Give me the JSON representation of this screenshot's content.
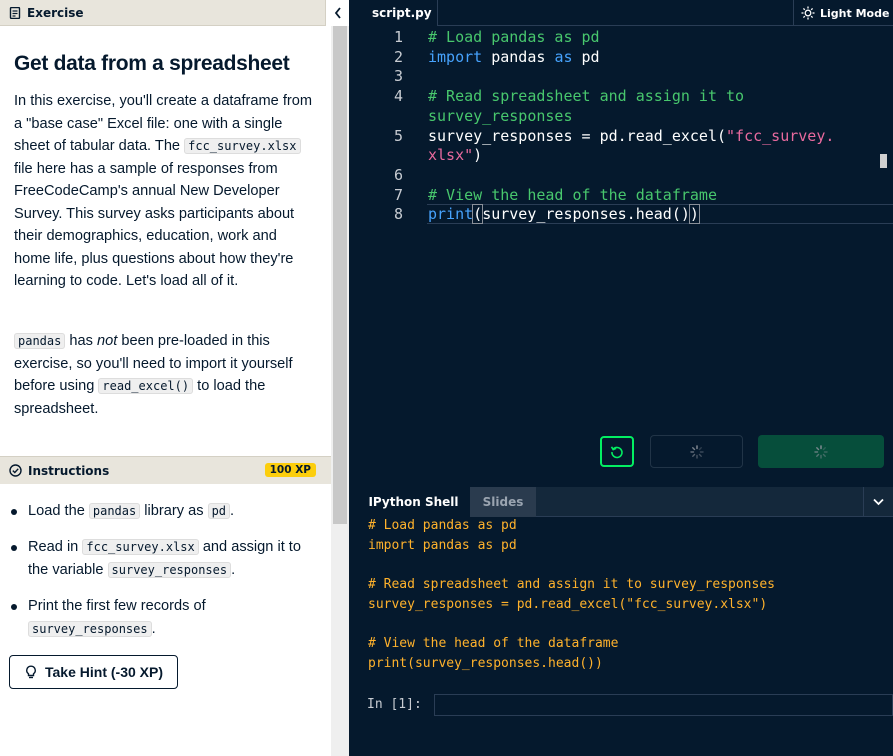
{
  "exercise_panel": {
    "header_label": "Exercise",
    "title": "Get data from a spreadsheet",
    "para1": {
      "t1": "In this exercise, you'll create a dataframe from a \"base case\" Excel file: one with a single sheet of tabular data. The",
      "code1": "fcc_survey.xlsx",
      "t2": "file here has a sample of responses from FreeCodeCamp's annual New Developer Survey. This survey asks participants about their demographics, education, work and home life, plus questions about how they're learning to code. Let's load all of it."
    },
    "para2": {
      "code1": "pandas",
      "t1": "has",
      "em": "not",
      "t2": "been pre-loaded in this exercise, so you'll need to import it yourself before using",
      "code2": "read_excel()",
      "t3": "to load the spreadsheet."
    },
    "instructions_label": "Instructions",
    "xp_badge": "100 XP",
    "bullet1": {
      "t1": "Load the",
      "code1": "pandas",
      "t2": "library as",
      "code2": "pd",
      "t3": "."
    },
    "bullet2": {
      "t1": "Read in",
      "code1": "fcc_survey.xlsx",
      "t2": "and assign it to the variable",
      "code2": "survey_responses",
      "t3": "."
    },
    "bullet3": {
      "t1": "Print the first few records of",
      "code1": "survey_responses",
      "t2": "."
    },
    "hint_button": "Take Hint (-30 XP)"
  },
  "editor": {
    "tab": "script.py",
    "light_mode": "Light Mode",
    "line_numbers": [
      "1",
      "2",
      "3",
      "4",
      "5",
      "6",
      "7",
      "8"
    ],
    "l1": "# Load pandas as pd",
    "l2_kw1": "import",
    "l2_mid": " pandas ",
    "l2_kw2": "as",
    "l2_end": " pd",
    "l4a": "# Read spreadsheet and assign it to",
    "l4b": "survey_responses",
    "l5a_pre": "survey_responses = pd.read_excel(",
    "l5a_str": "\"fcc_survey.",
    "l5b_str": "xlsx\"",
    "l5b_end": ")",
    "l7": "# View the head of the dataframe",
    "l8_kw": "print",
    "l8_open": "(",
    "l8_mid": "survey_responses.head()",
    "l8_close": ")"
  },
  "console": {
    "tab_shell": "IPython Shell",
    "tab_slides": "Slides",
    "output": [
      "# Load pandas as pd",
      "import pandas as pd",
      "",
      "# Read spreadsheet and assign it to survey_responses",
      "survey_responses = pd.read_excel(\"fcc_survey.xlsx\")",
      "",
      "# View the head of the dataframe",
      "print(survey_responses.head())"
    ],
    "prompt": "In [1]:"
  }
}
